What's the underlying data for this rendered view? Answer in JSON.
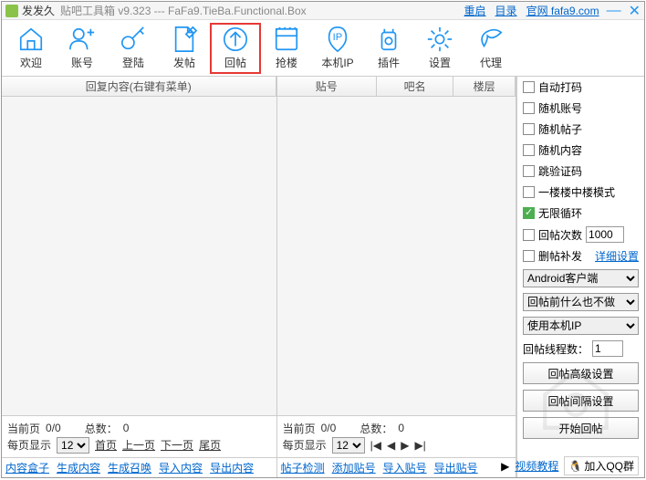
{
  "titlebar": {
    "app_name": "发发久",
    "subtitle": "贴吧工具箱 v9.323 --- FaFa9.TieBa.Functional.Box",
    "restart": "重启",
    "catalog": "目录",
    "official": "官网 fafa9.com"
  },
  "toolbar": {
    "items": [
      {
        "label": "欢迎"
      },
      {
        "label": "账号"
      },
      {
        "label": "登陆"
      },
      {
        "label": "发帖"
      },
      {
        "label": "回帖"
      },
      {
        "label": "抢楼"
      },
      {
        "label": "本机IP"
      },
      {
        "label": "插件"
      },
      {
        "label": "设置"
      },
      {
        "label": "代理"
      }
    ]
  },
  "left_grid": {
    "col_reply": "回复内容(右键有菜单)"
  },
  "mid_grid": {
    "col_tie": "贴号",
    "col_ba": "吧名",
    "col_floor": "楼层"
  },
  "pager_left": {
    "current": "当前页",
    "pages": "0/0",
    "total_lbl": "总数：",
    "total_val": "0",
    "perpage": "每页显示",
    "perpage_val": "12",
    "first": "首页",
    "prev": "上一页",
    "next": "下一页",
    "last": "尾页"
  },
  "pager_mid": {
    "current": "当前页",
    "pages": "0/0",
    "total_lbl": "总数：",
    "total_val": "0",
    "perpage": "每页显示",
    "perpage_val": "12"
  },
  "links_left": {
    "a": "内容盒子",
    "b": "生成内容",
    "c": "生成召唤",
    "d": "导入内容",
    "e": "导出内容"
  },
  "links_mid": {
    "a": "帖子检测",
    "b": "添加贴号",
    "c": "导入贴号",
    "d": "导出贴号"
  },
  "options": {
    "auto_code": "自动打码",
    "rand_acc": "随机账号",
    "rand_tie": "随机帖子",
    "rand_content": "随机内容",
    "skip_verify": "跳验证码",
    "floor_mode": "一楼楼中楼模式",
    "infinite": "无限循环",
    "reply_count": "回帖次数",
    "reply_count_val": "1000",
    "del_sup": "删帖补发",
    "detail": "详细设置",
    "client_sel": "Android客户端",
    "before_sel": "回帖前什么也不做",
    "ip_sel": "使用本机IP",
    "threads_lbl": "回帖线程数：",
    "threads_val": "1",
    "btn_adv": "回帖高级设置",
    "btn_interval": "回帖间隔设置",
    "btn_start": "开始回帖"
  },
  "footer": {
    "video": "视频教程",
    "qq": "加入QQ群"
  }
}
